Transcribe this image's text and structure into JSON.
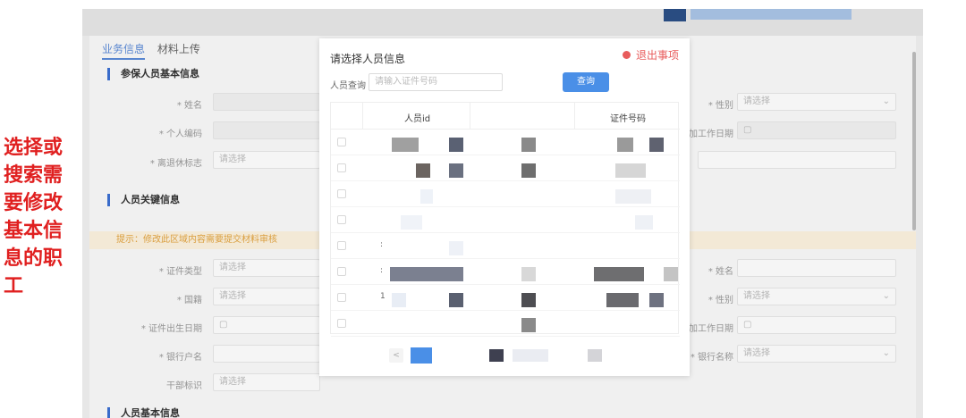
{
  "annotation": "选择或搜索需要修改基本信息的职工",
  "tabs": [
    {
      "label": "业务信息",
      "active": true
    },
    {
      "label": "材料上传",
      "active": false
    }
  ],
  "sections": {
    "basic": "参保人员基本信息",
    "key": "人员关键信息",
    "person": "人员基本信息"
  },
  "hint": "提示：修改此区域内容需要提交材料审核",
  "fields": {
    "name": "姓名",
    "personal_no": "个人编码",
    "retire_flag": "离退休标志",
    "id_type": "证件类型",
    "nationality": "国籍",
    "birthdate": "证件出生日期",
    "bank_account_name": "银行户名",
    "cadre_flag": "干部标识",
    "gender": "性别",
    "work_date": "加工作日期",
    "name2": "姓名",
    "gender2": "性别",
    "work_date2": "加工作日期",
    "bank_name": "银行名称",
    "select_placeholder": "请选择"
  },
  "modal": {
    "title": "请选择人员信息",
    "exit_label": "退出事项",
    "query_label": "人员查询",
    "query_placeholder": "请输入证件号码",
    "search_button": "查询",
    "columns": [
      "人员id",
      "证件号码"
    ],
    "row_prefixes": [
      "",
      "",
      "",
      "",
      ":",
      ":",
      "1",
      ""
    ],
    "prev_label": "<"
  },
  "colors": {
    "accent": "#4a8fe7",
    "exit": "#e85c5c",
    "annotation": "#e02020"
  }
}
